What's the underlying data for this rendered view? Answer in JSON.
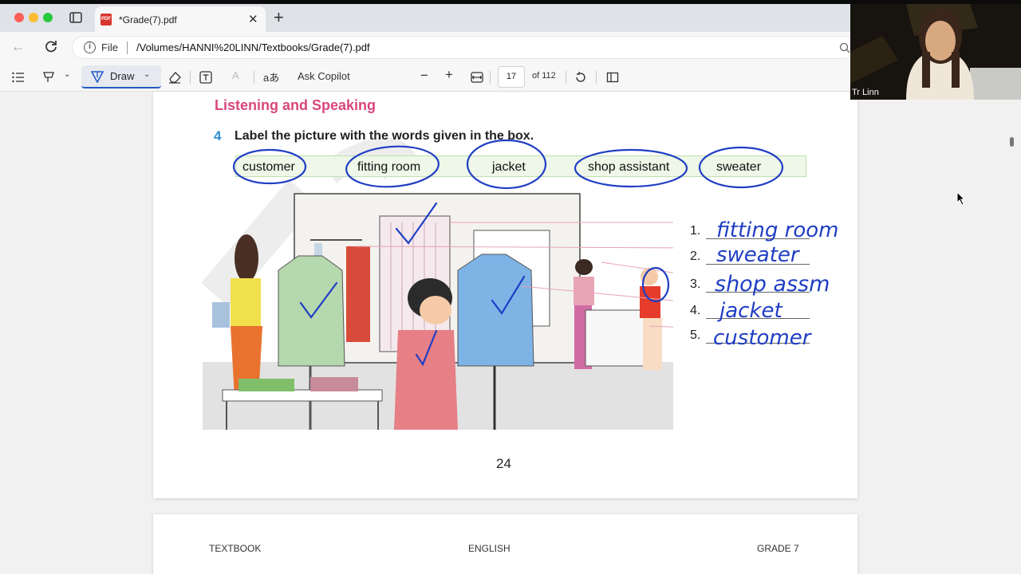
{
  "browser": {
    "tab_title": "*Grade(7).pdf",
    "pdf_icon_text": "PDF",
    "address_scheme_label": "File",
    "url": "/Volumes/HANNI%20LINN/Textbooks/Grade(7).pdf"
  },
  "toolbar": {
    "draw_label": "Draw",
    "read_aloud_label": "aあ",
    "copilot_label": "Ask Copilot",
    "current_page": "17",
    "total_pages_label": "of 112"
  },
  "pdf_page": {
    "section_title": "Listening and Speaking",
    "exercise_number": "4",
    "exercise_instruction": "Label the picture with the words given in the box.",
    "word_box": [
      "customer",
      "fitting room",
      "jacket",
      "shop assistant",
      "sweater"
    ],
    "numbered_labels": [
      "1.",
      "2.",
      "3.",
      "4.",
      "5."
    ],
    "page_number": "24"
  },
  "handwritten_answers": [
    "fitting room",
    "sweater",
    "shop assm",
    "jacket",
    "customer"
  ],
  "next_page_footer": {
    "left": "TEXTBOOK",
    "center": "ENGLISH",
    "right": "GRADE 7"
  },
  "webcam": {
    "participant_name": "Tr Linn"
  },
  "colors": {
    "ink": "#1f3ec4",
    "section_title": "#d9467c",
    "exercise_number": "#2e8fd0",
    "word_box_bg": "#eef7e8",
    "draw_accent": "#2559c9"
  }
}
